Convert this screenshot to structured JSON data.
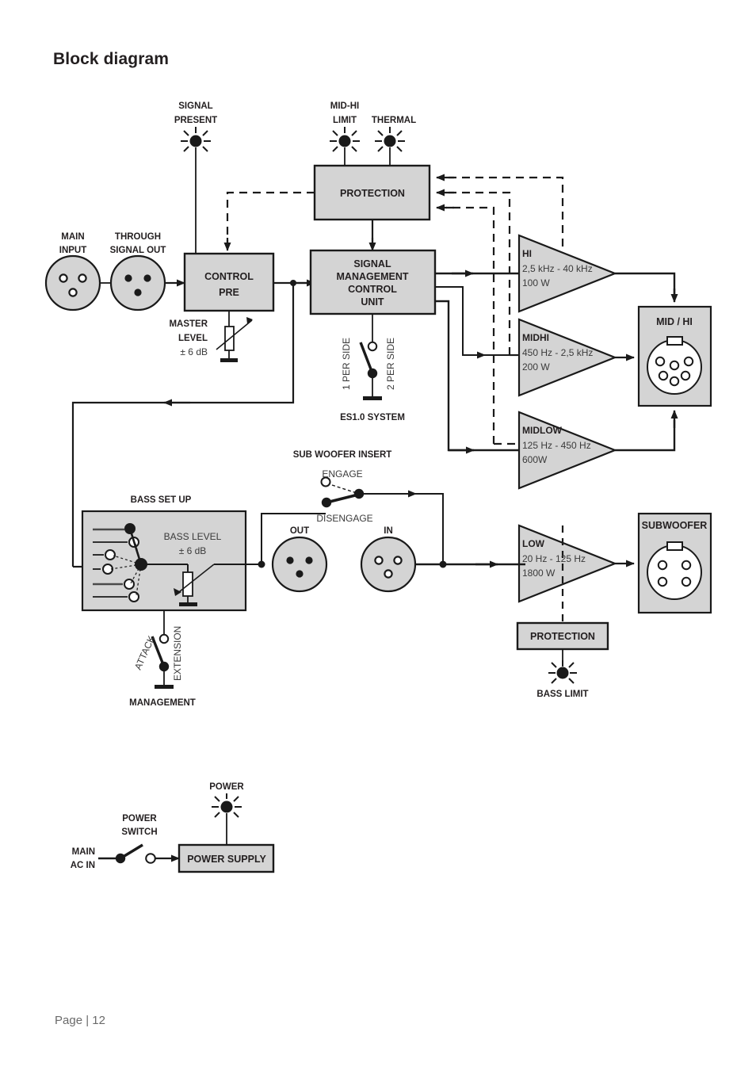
{
  "page": {
    "title": "Block diagram",
    "footer": "Page | 12"
  },
  "leds": {
    "signal_present": "SIGNAL\nPRESENT",
    "signal_present_l1": "SIGNAL",
    "signal_present_l2": "PRESENT",
    "mid_hi_limit_l1": "MID-HI",
    "mid_hi_limit_l2": "LIMIT",
    "thermal": "THERMAL",
    "bass_limit": "BASS LIMIT",
    "power": "POWER"
  },
  "connectors": {
    "main_input_l1": "MAIN",
    "main_input_l2": "INPUT",
    "through_out_l1": "THROUGH",
    "through_out_l2": "SIGNAL OUT",
    "sub_out": "OUT",
    "sub_in": "IN",
    "mid_hi": "MID / HI",
    "subwoofer": "SUBWOOFER"
  },
  "blocks": {
    "protection_top": "PROTECTION",
    "protection_bass": "PROTECTION",
    "control_pre_l1": "CONTROL",
    "control_pre_l2": "PRE",
    "smcu_l1": "SIGNAL",
    "smcu_l2": "MANAGEMENT",
    "smcu_l3": "CONTROL",
    "smcu_l4": "UNIT",
    "power_supply": "POWER SUPPLY"
  },
  "controls": {
    "master_level_l1": "MASTER",
    "master_level_l2": "LEVEL",
    "master_level_l3": "± 6 dB",
    "bass_level_l1": "BASS LEVEL",
    "bass_level_l2": "± 6 dB",
    "bass_setup": "BASS SET UP",
    "es10_system": "ES1.0 SYSTEM",
    "one_per_side": "1 PER SIDE",
    "two_per_side": "2 PER SIDE",
    "attack": "ATTACK",
    "extension": "EXTENSION",
    "management": "MANAGEMENT",
    "sub_woofer_insert": "SUB WOOFER INSERT",
    "engage": "ENGAGE",
    "disengage": "DISENGAGE",
    "power_switch_l1": "POWER",
    "power_switch_l2": "SWITCH",
    "main_ac_in_l1": "MAIN",
    "main_ac_in_l2": "AC IN"
  },
  "amps": [
    {
      "id": "hi",
      "name": "HI",
      "range": "2,5 kHz - 40 kHz",
      "power": "100 W"
    },
    {
      "id": "midhi",
      "name": "MIDHI",
      "range": "450 Hz - 2,5 kHz",
      "power": "200 W"
    },
    {
      "id": "midlow",
      "name": "MIDLOW",
      "range": "125 Hz - 450 Hz",
      "power": "600W"
    },
    {
      "id": "low",
      "name": "LOW",
      "range": "20 Hz - 125 Hz",
      "power": "1800 W"
    }
  ],
  "colors": {
    "fill_gray": "#d4d4d4",
    "stroke": "#1a1a1a",
    "text": "#231f20",
    "subtext": "#3a3a3a",
    "footer": "#6a6a6a"
  }
}
